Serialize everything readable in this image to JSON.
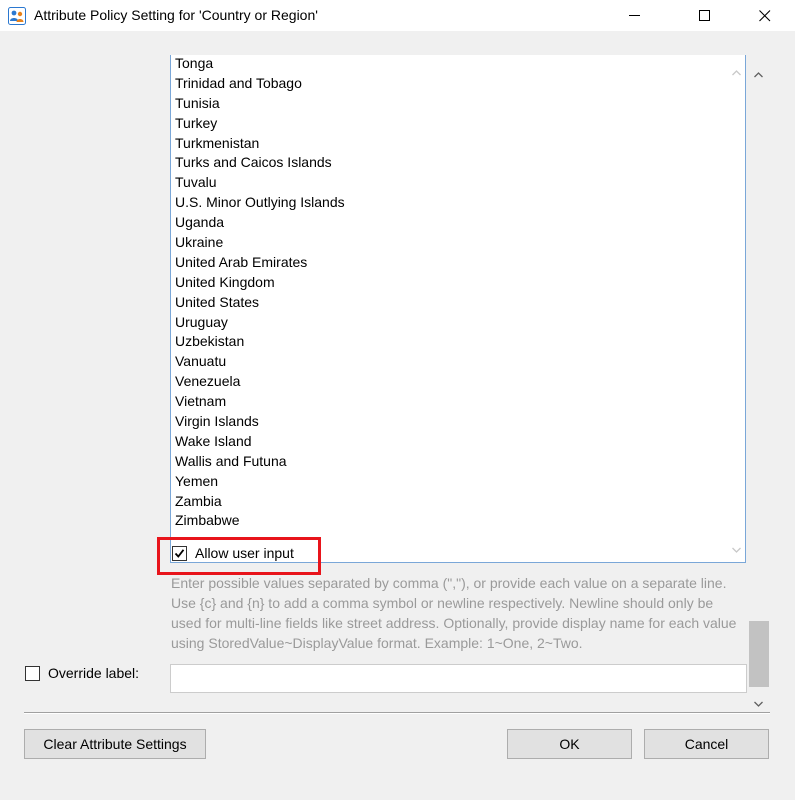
{
  "window": {
    "title": "Attribute Policy Setting for 'Country or Region'",
    "icon": "people-icon"
  },
  "list": {
    "items": [
      "Tonga",
      "Trinidad and Tobago",
      "Tunisia",
      "Turkey",
      "Turkmenistan",
      "Turks and Caicos Islands",
      "Tuvalu",
      "U.S. Minor Outlying Islands",
      "Uganda",
      "Ukraine",
      "United Arab Emirates",
      "United Kingdom",
      "United States",
      "Uruguay",
      "Uzbekistan",
      "Vanuatu",
      "Venezuela",
      "Vietnam",
      "Virgin Islands",
      "Wake Island",
      "Wallis and Futuna",
      "Yemen",
      "Zambia",
      "Zimbabwe"
    ]
  },
  "allow_user_input": {
    "label": "Allow user input",
    "checked": true
  },
  "help_text": "Enter possible values separated by comma (\",\"), or provide each value on a separate line. Use {c} and {n} to add a comma symbol or newline respectively. Newline should only be used for multi-line fields like street address. Optionally, provide display name for each value using StoredValue~DisplayValue format. Example: 1~One, 2~Two.",
  "override_label": {
    "label": "Override label:",
    "checked": false,
    "value": ""
  },
  "buttons": {
    "clear": "Clear Attribute Settings",
    "ok": "OK",
    "cancel": "Cancel"
  },
  "colors": {
    "highlight": "#e8141b",
    "list_border": "#7aa7d8",
    "help_text": "#9a9a9a"
  }
}
